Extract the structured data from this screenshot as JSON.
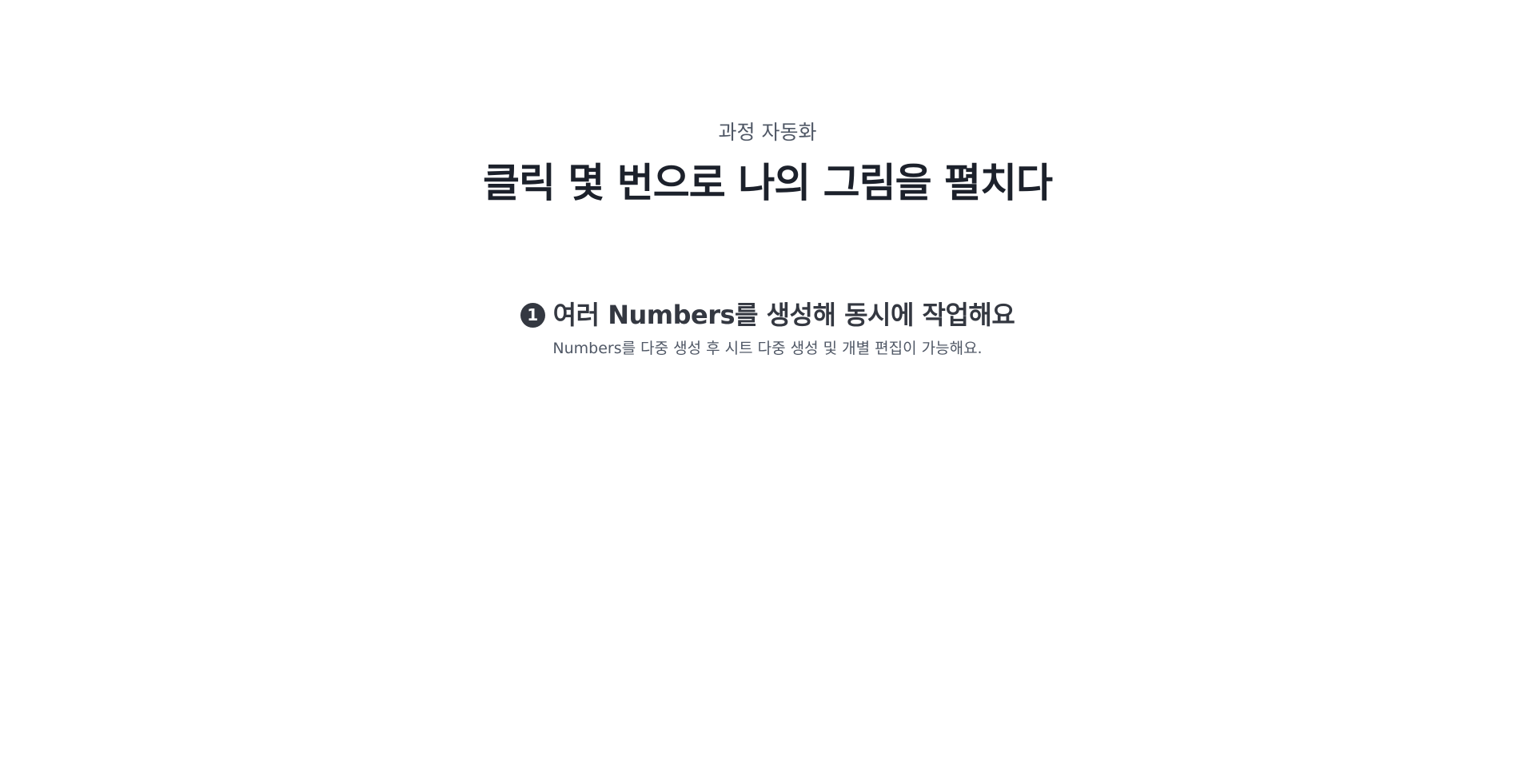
{
  "hero": {
    "eyebrow": "과정 자동화",
    "headline": "클릭 몇 번으로 나의 그림을 펼치다"
  },
  "feature": {
    "step_number": "1",
    "title": "여러 Numbers를 생성해 동시에 작업해요",
    "description": "Numbers를 다중 생성 후 시트 다중 생성 및 개별 편집이 가능해요."
  },
  "colors": {
    "background": "#ffffff",
    "headline": "#1c212b",
    "feature_title": "#343841",
    "body_text": "#505866",
    "badge": "#343841"
  }
}
